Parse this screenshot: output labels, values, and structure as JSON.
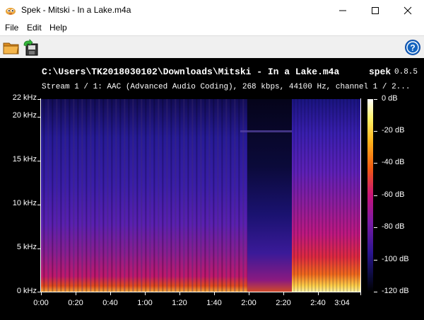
{
  "window": {
    "title": "Spek - Mitski - In a Lake.m4a",
    "app_icon": "spek-app-icon",
    "controls": [
      "minimize-icon",
      "maximize-icon",
      "close-icon"
    ]
  },
  "menu": {
    "file": "File",
    "edit": "Edit",
    "help": "Help"
  },
  "toolbar": {
    "icons": [
      "open-folder-icon",
      "save-icon",
      "help-icon"
    ]
  },
  "header": {
    "path": "C:\\Users\\TK2018030102\\Downloads\\Mitski - In a Lake.m4a",
    "app_name": "spek",
    "version": "0.8.5",
    "stream_info": "Stream 1 / 1: AAC (Advanced Audio Coding), 268 kbps, 44100 Hz, channel 1 / 2..."
  },
  "axes": {
    "freq_ticks": [
      "22 kHz",
      "20 kHz",
      "15 kHz",
      "10 kHz",
      "5 kHz",
      "0 kHz"
    ],
    "time_ticks": [
      "0:00",
      "0:20",
      "0:40",
      "1:00",
      "1:20",
      "1:40",
      "2:00",
      "2:20",
      "2:40",
      "3:04"
    ],
    "db_ticks": [
      "0 dB",
      "-20 dB",
      "-40 dB",
      "-60 dB",
      "-80 dB",
      "-100 dB",
      "-120 dB"
    ]
  },
  "colors": {
    "background": "#000000",
    "titlebar": "#ffffff",
    "toolbar": "#f0f0f0",
    "help_blue": "#1565c0"
  }
}
